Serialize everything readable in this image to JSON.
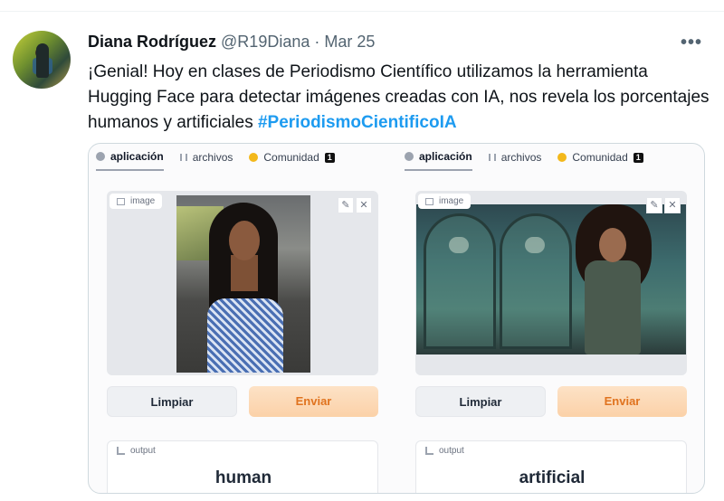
{
  "tweet": {
    "author_name": "Diana Rodríguez",
    "handle": "@R19Diana",
    "separator": "·",
    "date": "Mar 25",
    "more_icon": "more-horizontal-icon",
    "text": "¡Genial! Hoy en clases de Periodismo Científico utilizamos la herramienta Hugging Face para detectar imágenes creadas con IA, nos revela los porcentajes humanos y artificiales",
    "hashtag": "#PeriodismoCientificoIA"
  },
  "colors": {
    "link": "#1d9bf0",
    "submit_text": "#e0731f",
    "submit_bg": "#fbd1a8"
  },
  "panes": [
    {
      "tabs": [
        {
          "label": "aplicación",
          "icon": "app-icon",
          "active": true
        },
        {
          "label": "archivos",
          "icon": "files-icon"
        },
        {
          "label": "Comunidad",
          "icon": "community-icon",
          "badge": "1"
        }
      ],
      "image_label": "image",
      "edit_icon": "pencil-icon",
      "close_icon": "close-icon",
      "clear_label": "Limpiar",
      "submit_label": "Enviar",
      "output_label": "output",
      "result": "human"
    },
    {
      "tabs": [
        {
          "label": "aplicación",
          "icon": "app-icon",
          "active": true
        },
        {
          "label": "archivos",
          "icon": "files-icon"
        },
        {
          "label": "Comunidad",
          "icon": "community-icon",
          "badge": "1"
        }
      ],
      "image_label": "image",
      "edit_icon": "pencil-icon",
      "close_icon": "close-icon",
      "clear_label": "Limpiar",
      "submit_label": "Enviar",
      "output_label": "output",
      "result": "artificial"
    }
  ]
}
